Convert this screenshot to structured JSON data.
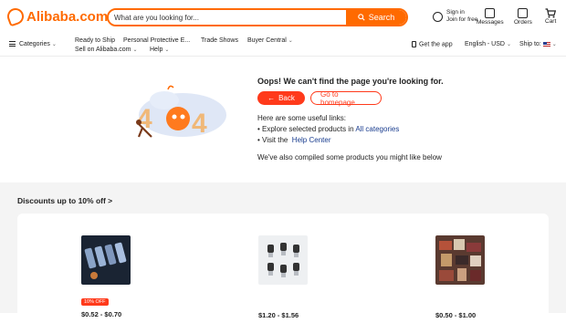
{
  "header": {
    "logo_text": "Alibaba.com",
    "search_placeholder": "What are you looking for...",
    "search_button": "Search",
    "sign_in": "Sign in",
    "join": "Join for free",
    "messages": "Messages",
    "orders": "Orders",
    "cart": "Cart",
    "brand_color": "#ff6a00"
  },
  "nav": {
    "categories": "Categories",
    "ready_to_ship": "Ready to Ship",
    "ppe": "Personal Protective E...",
    "trade_shows": "Trade Shows",
    "buyer_central": "Buyer Central",
    "sell": "Sell on Alibaba.com",
    "help": "Help",
    "get_app": "Get the app",
    "language": "English - USD",
    "ship_to": "Ship to:"
  },
  "error": {
    "title": "Oops! We can't find the page you're looking for.",
    "back_label": "Back",
    "home_label": "Go to homepage",
    "links_intro": "Here are some useful links:",
    "explore_prefix": "• Explore selected products in",
    "explore_link": "All categories",
    "visit_prefix": "• Visit the",
    "visit_link": "Help Center",
    "compiled": "We've also compiled some products you might like below",
    "accent_color": "#ff3a1b"
  },
  "recommendations": {
    "title": "Discounts up to 10% off >",
    "products": [
      {
        "discount": "10% OFF",
        "price": "$0.52 - $0.70"
      },
      {
        "discount": "",
        "price": "$1.20 - $1.56"
      },
      {
        "discount": "",
        "price": "$0.50 - $1.00"
      }
    ]
  }
}
